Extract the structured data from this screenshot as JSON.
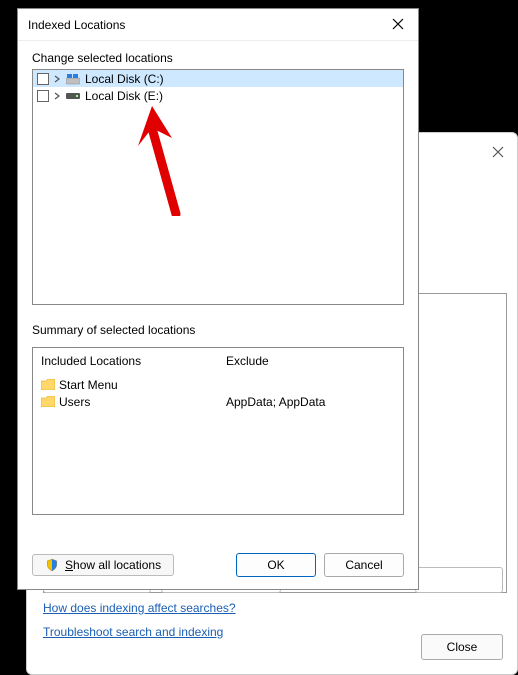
{
  "bgWindow": {
    "buttons": [
      "",
      "",
      ""
    ],
    "link1": "How does indexing affect searches?",
    "link2": "Troubleshoot search and indexing",
    "close": "Close"
  },
  "dialog": {
    "title": "Indexed Locations",
    "changeLabel": "Change selected locations",
    "tree": [
      {
        "label": "Local Disk (C:)",
        "selected": true,
        "icon": "win"
      },
      {
        "label": "Local Disk (E:)",
        "selected": false,
        "icon": "drive"
      }
    ],
    "summaryLabel": "Summary of selected locations",
    "includedHeader": "Included Locations",
    "excludeHeader": "Exclude",
    "included": [
      "Start Menu",
      "Users"
    ],
    "exclude": "AppData; AppData",
    "showAll": "how all locations",
    "showAllAccel": "S",
    "ok": "OK",
    "cancel": "Cancel"
  }
}
